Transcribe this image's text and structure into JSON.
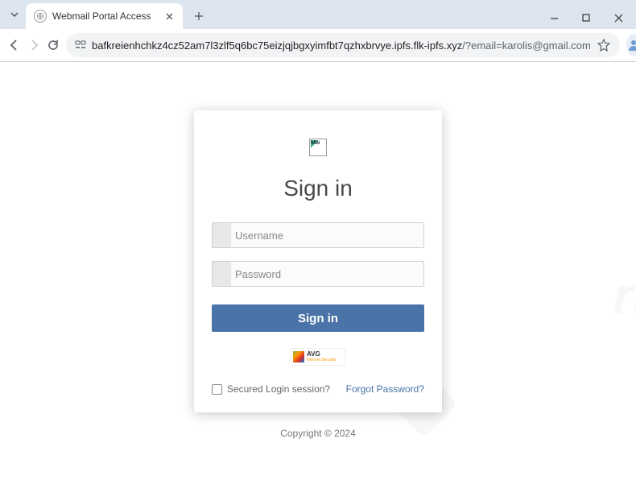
{
  "browser": {
    "tab_title": "Webmail Portal Access",
    "url_host": "bafkreienhchkz4cz52am7l3zlf5q6bc75eizjqjbgxyimfbt7qzhxbrvye.ipfs.flk-ipfs.xyz",
    "url_query": "/?email=karolis@gmail.com"
  },
  "login": {
    "broken_alt": "Mai",
    "title": "Sign in",
    "username_placeholder": "Username",
    "password_placeholder": "Password",
    "submit_label": "Sign in",
    "avg_brand": "AVG",
    "avg_sub": "Internet Security",
    "secured_label": "Secured Login session?",
    "forgot_label": "Forgot Password?"
  },
  "footer": {
    "copyright": "Copyright © 2024"
  }
}
